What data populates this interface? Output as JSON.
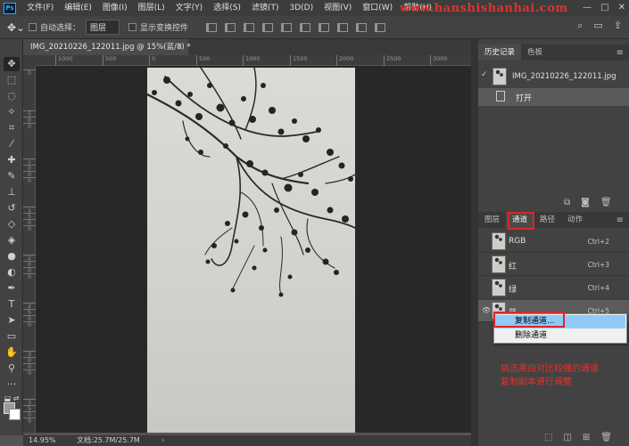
{
  "app": {
    "logo": "Ps"
  },
  "menu": [
    "文件(F)",
    "编辑(E)",
    "图像(I)",
    "图层(L)",
    "文字(Y)",
    "选择(S)",
    "滤镜(T)",
    "3D(D)",
    "视图(V)",
    "窗口(W)",
    "帮助(H)"
  ],
  "watermark": "www.hanshishanhai.com",
  "window_controls": [
    "—",
    "□",
    "✕"
  ],
  "options": {
    "auto_select_label": "自动选择：",
    "auto_select_value": "图层",
    "show_transform_label": "显示变换控件"
  },
  "document": {
    "tab_title": "IMG_20210226_122011.jpg @ 15%(蓝/8) *",
    "close": "×"
  },
  "ruler_h": [
    "1000",
    "500",
    "0",
    "500",
    "1000",
    "1500",
    "2000",
    "2500",
    "3000"
  ],
  "ruler_v": [
    "0",
    "5",
    "0",
    "0",
    "1",
    "0",
    "0",
    "0",
    "1",
    "5",
    "0",
    "0",
    "2",
    "0",
    "0",
    "0",
    "2",
    "5",
    "0",
    "0",
    "3",
    "0",
    "0",
    "0",
    "3",
    "5",
    "0",
    "0"
  ],
  "status": {
    "zoom": "14.95%",
    "doc": "文档:25.7M/25.7M",
    "arrow": "›"
  },
  "history_panel": {
    "tabs": [
      "历史记录",
      "色板"
    ],
    "snapshot_name": "IMG_20210226_122011.jpg",
    "step_open": "打开"
  },
  "channels_panel": {
    "tabs": [
      "图层",
      "通道",
      "路径",
      "动作"
    ],
    "rows": [
      {
        "name": "RGB",
        "shortcut": "Ctrl+2"
      },
      {
        "name": "红",
        "shortcut": "Ctrl+3"
      },
      {
        "name": "绿",
        "shortcut": "Ctrl+4"
      },
      {
        "name": "蓝",
        "shortcut": "Ctrl+5"
      }
    ]
  },
  "context_menu": {
    "duplicate": "复制通道...",
    "delete": "删除通道"
  },
  "annotation": {
    "line1": "挑选黑白对比较强的通道",
    "line2": "复制副本进行调整"
  },
  "colors": {
    "accent_red": "#e0252a",
    "menu_highlight": "#91c9f7"
  }
}
